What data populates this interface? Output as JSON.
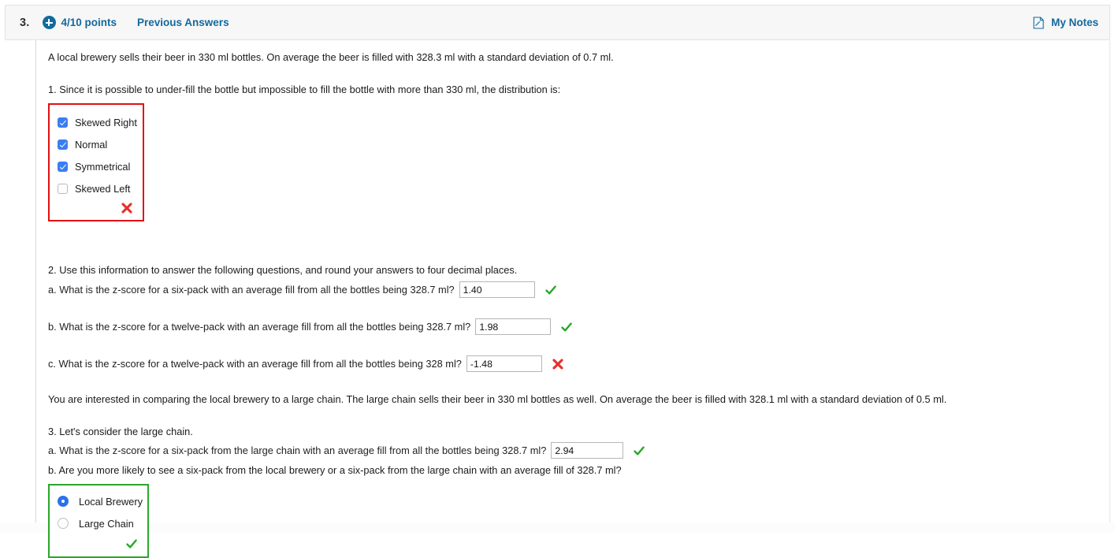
{
  "header": {
    "question_number": "3.",
    "plus_icon": "plus-circle-icon",
    "points": "4/10 points",
    "previous_answers": "Previous Answers",
    "notes_icon": "note-page-icon",
    "notes_label": "My Notes",
    "link_color": "#13699d",
    "bar_background": "#f7f7f7"
  },
  "content": {
    "intro": "A local brewery sells their beer in 330 ml bottles. On average the beer is filled with 328.3 ml with a standard deviation of 0.7 ml.",
    "q1": {
      "prompt": "1. Since it is possible to under-fill the bottle but impossible to fill the bottle with more than 330 ml, the distribution is:",
      "type": "checkbox",
      "border_color": "#e21010",
      "result": "incorrect",
      "result_icon": "red-x-icon",
      "options": [
        {
          "label": "Skewed Right",
          "checked": true
        },
        {
          "label": "Normal",
          "checked": true
        },
        {
          "label": "Symmetrical",
          "checked": true
        },
        {
          "label": "Skewed Left",
          "checked": false
        }
      ]
    },
    "q2": {
      "prompt": "2. Use this information to answer the following questions, and round your answers to four decimal places.",
      "items": [
        {
          "label": "a. What is the z-score for a six-pack with an average fill from all the bottles being 328.7 ml?",
          "value": "1.40",
          "result": "correct",
          "result_icon": "green-check-icon",
          "input_width": 96
        },
        {
          "label": "b. What is the z-score for a twelve-pack with an average fill from all the bottles being 328.7 ml?",
          "value": "1.98",
          "result": "correct",
          "result_icon": "green-check-icon",
          "input_width": 96
        },
        {
          "label": "c. What is the z-score for a twelve-pack with an average fill from all the bottles being 328 ml?",
          "value": "-1.48",
          "result": "incorrect",
          "result_icon": "red-x-icon",
          "input_width": 96
        }
      ]
    },
    "chain_intro": "You are interested in comparing the local brewery to a large chain. The large chain sells their beer in 330 ml bottles as well. On average the beer is filled with 328.1 ml with a standard deviation of 0.5 ml.",
    "q3": {
      "prompt": "3. Let's consider the large chain.",
      "item_a": {
        "label": "a. What is the z-score for a six-pack from the large chain with an average fill from all the bottles being 328.7 ml?",
        "value": "2.94",
        "result": "correct",
        "result_icon": "green-check-icon",
        "input_width": 92
      },
      "item_b": {
        "label": "b. Are you more likely to see a six-pack from the local brewery or a six-pack from the large chain with an average fill of 328.7 ml?",
        "type": "radio",
        "border_color": "#2aa82a",
        "result": "correct",
        "result_icon": "green-check-icon",
        "options": [
          {
            "label": "Local Brewery",
            "selected": true
          },
          {
            "label": "Large Chain",
            "selected": false
          }
        ]
      }
    }
  }
}
